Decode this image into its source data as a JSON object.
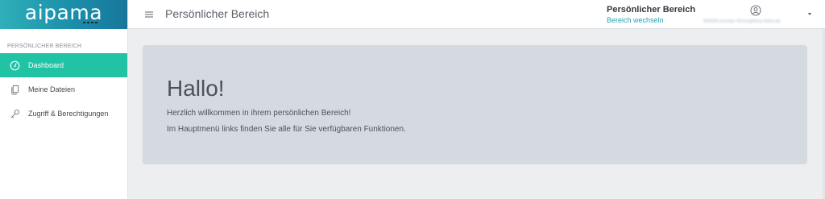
{
  "brand": {
    "logo_text": "aipama",
    "gradient_start": "#2fb0b8",
    "gradient_end": "#17779a"
  },
  "sidebar": {
    "section_label": "PERSÖNLICHER BEREICH",
    "active_color": "#20c4a5",
    "items": [
      {
        "label": "Dashboard",
        "icon": "dashboard-gauge-icon",
        "active": true
      },
      {
        "label": "Meine Dateien",
        "icon": "files-copy-icon",
        "active": false
      },
      {
        "label": "Zugriff & Berechtigungen",
        "icon": "key-icon",
        "active": false
      }
    ]
  },
  "header": {
    "menu_icon": "hamburger-menu-icon",
    "page_title": "Persönlicher Bereich",
    "area_title": "Persönlicher Bereich",
    "area_switch_link": "Bereich wechseln",
    "user_icon": "user-circle-icon",
    "user_email": "99999.muster-firma@test.bdw.de",
    "dropdown_icon": "caret-down-icon"
  },
  "main": {
    "card": {
      "heading": "Hallo!",
      "line1": "Herzlich willkommen in ihrem persönlichen Bereich!",
      "line2": "Im Hauptmenü links finden Sie alle für Sie verfügbaren Funktionen."
    }
  }
}
